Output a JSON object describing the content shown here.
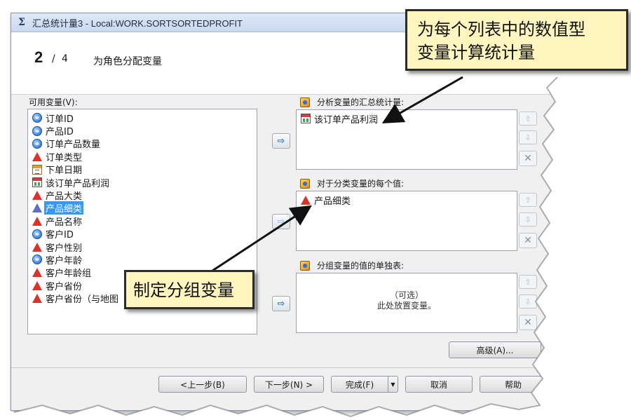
{
  "window": {
    "title": "汇总统计量3 - Local:WORK.SORTSORTEDPROFIT",
    "title_icon": "sigma-icon"
  },
  "wizard": {
    "current_step": "2",
    "separator": "/",
    "total_steps": "4",
    "step_title": "为角色分配变量"
  },
  "available": {
    "label": "可用变量(V):",
    "items": [
      {
        "label": "订单ID",
        "icon": "numeric-variable-icon"
      },
      {
        "label": "产品ID",
        "icon": "numeric-variable-icon"
      },
      {
        "label": "订单产品数量",
        "icon": "numeric-variable-icon"
      },
      {
        "label": "订单类型",
        "icon": "category-variable-icon"
      },
      {
        "label": "下单日期",
        "icon": "date-variable-icon"
      },
      {
        "label": "该订单产品利润",
        "icon": "computed-variable-icon"
      },
      {
        "label": "产品大类",
        "icon": "category-variable-icon"
      },
      {
        "label": "产品细类",
        "icon": "category-variable-icon",
        "selected": true
      },
      {
        "label": "产品名称",
        "icon": "category-variable-icon"
      },
      {
        "label": "客户ID",
        "icon": "numeric-variable-icon"
      },
      {
        "label": "客户性别",
        "icon": "category-variable-icon"
      },
      {
        "label": "客户年龄",
        "icon": "numeric-variable-icon"
      },
      {
        "label": "客户年龄组",
        "icon": "category-variable-icon"
      },
      {
        "label": "客户省份",
        "icon": "category-variable-icon"
      },
      {
        "label": "客户省份（与地图",
        "icon": "category-variable-icon"
      }
    ]
  },
  "roles": {
    "analysis": {
      "label": "分析变量的汇总统计量:",
      "items": [
        "该订单产品利润"
      ]
    },
    "classification": {
      "label": "对于分类变量的每个值:",
      "items": [
        "产品细类"
      ]
    },
    "group": {
      "label": "分组变量的值的单独表:",
      "placeholder_line1": "（可选）",
      "placeholder_line2": "此处放置变量。"
    }
  },
  "buttons": {
    "advanced": "高级(A)...",
    "back": "<上一步(B)",
    "next": "下一步(N) >",
    "finish": "完成(F)",
    "cancel": "取消",
    "help": "帮助"
  },
  "annotations": {
    "top": {
      "line1": "为每个列表中的数值型",
      "line2": "变量计算统计量"
    },
    "left": "制定分组变量"
  }
}
